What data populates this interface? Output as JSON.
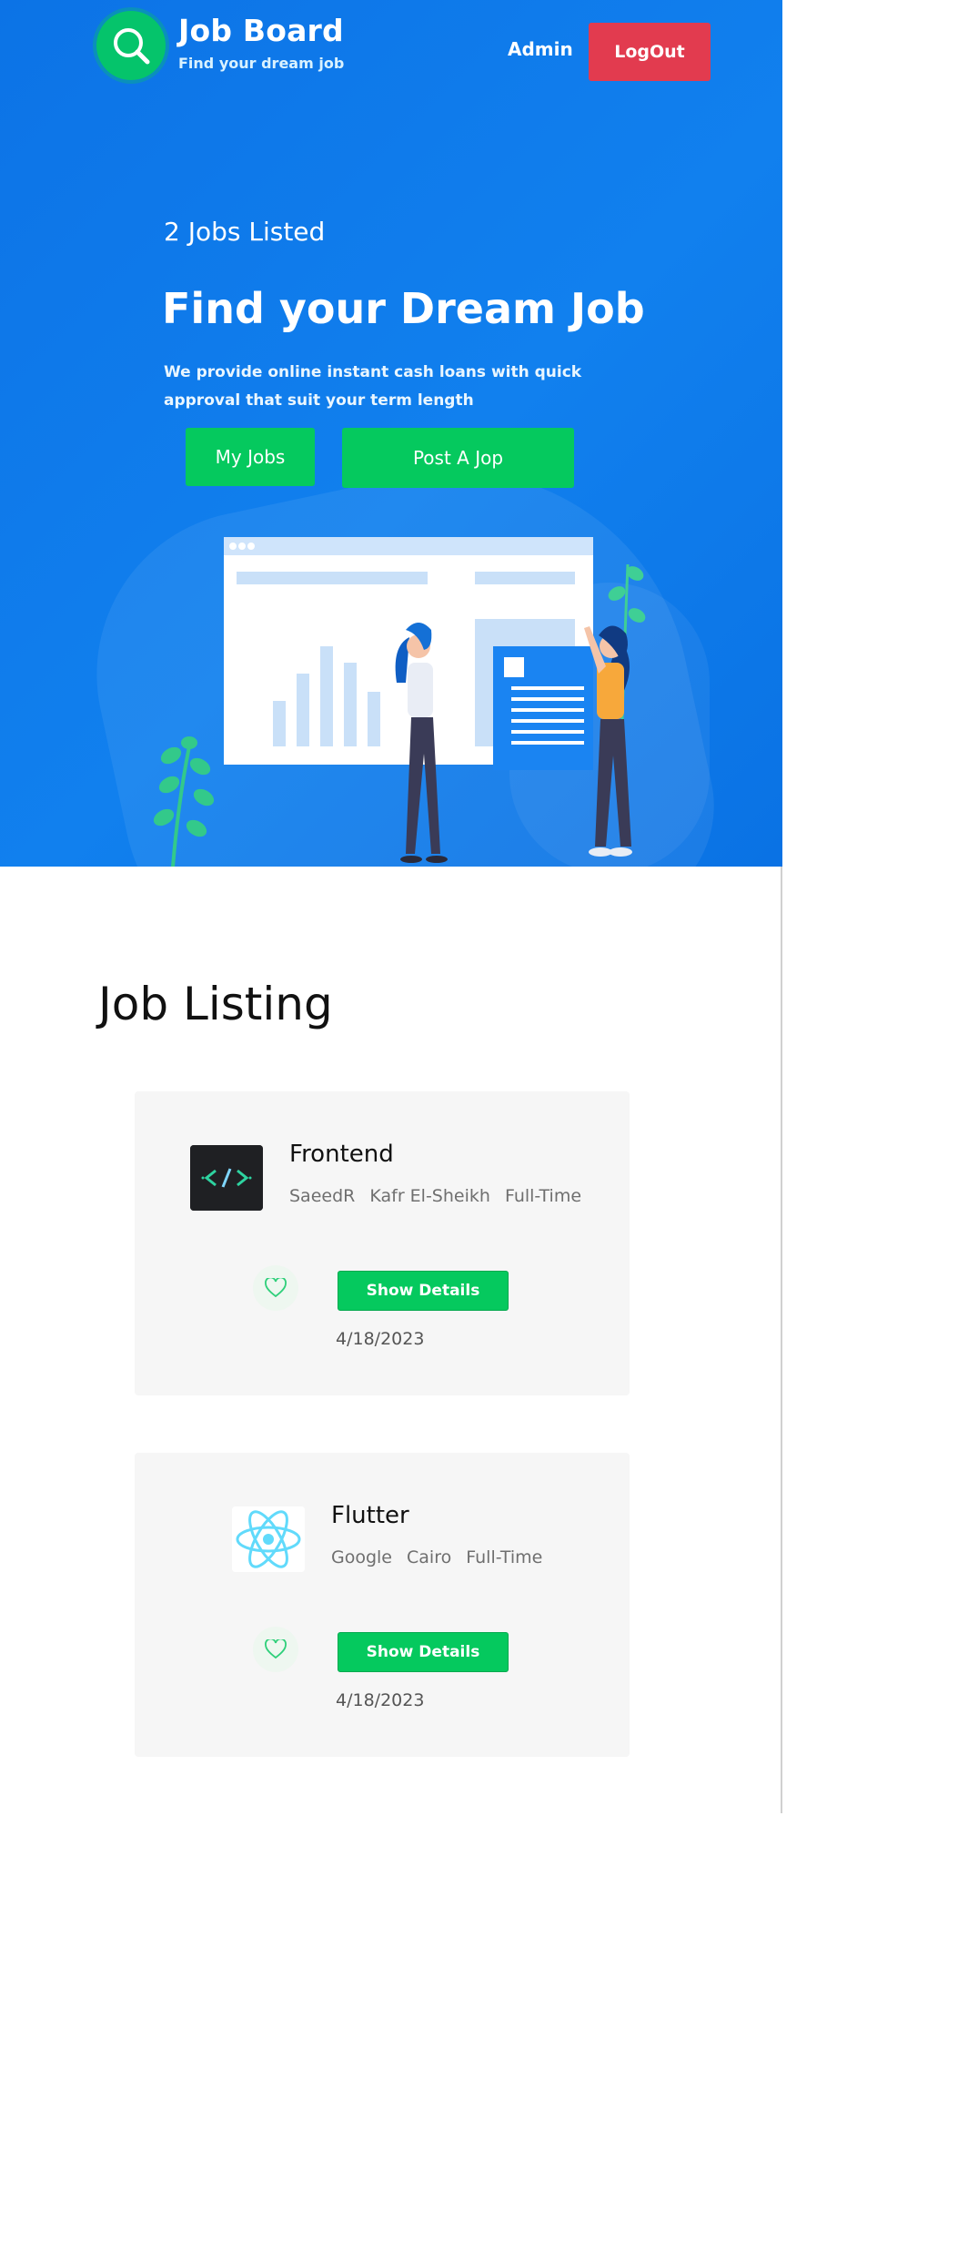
{
  "header": {
    "brand_title": "Job Board",
    "brand_subtitle": "Find your dream job",
    "admin_label": "Admin",
    "logout_label": "LogOut"
  },
  "hero": {
    "jobs_count": "2 Jobs Listed",
    "title": "Find your Dream Job",
    "description": "We provide online instant cash loans with quick approval that suit your term length",
    "my_jobs_label": "My Jobs",
    "post_job_label": "Post A Jop"
  },
  "listing": {
    "title": "Job Listing",
    "jobs": [
      {
        "title": "Frontend",
        "company": "SaeedR",
        "location": "Kafr El-Sheikh",
        "type": "Full-Time",
        "details_label": "Show Details",
        "date": "4/18/2023",
        "logo_icon": "code-icon"
      },
      {
        "title": "Flutter",
        "company": "Google",
        "location": "Cairo",
        "type": "Full-Time",
        "details_label": "Show Details",
        "date": "4/18/2023",
        "logo_icon": "react-icon"
      }
    ]
  },
  "colors": {
    "hero_blue": "#0c73e6",
    "accent_green": "#05c95e",
    "logout_red": "#e23b4f",
    "card_bg": "#f6f6f6"
  }
}
